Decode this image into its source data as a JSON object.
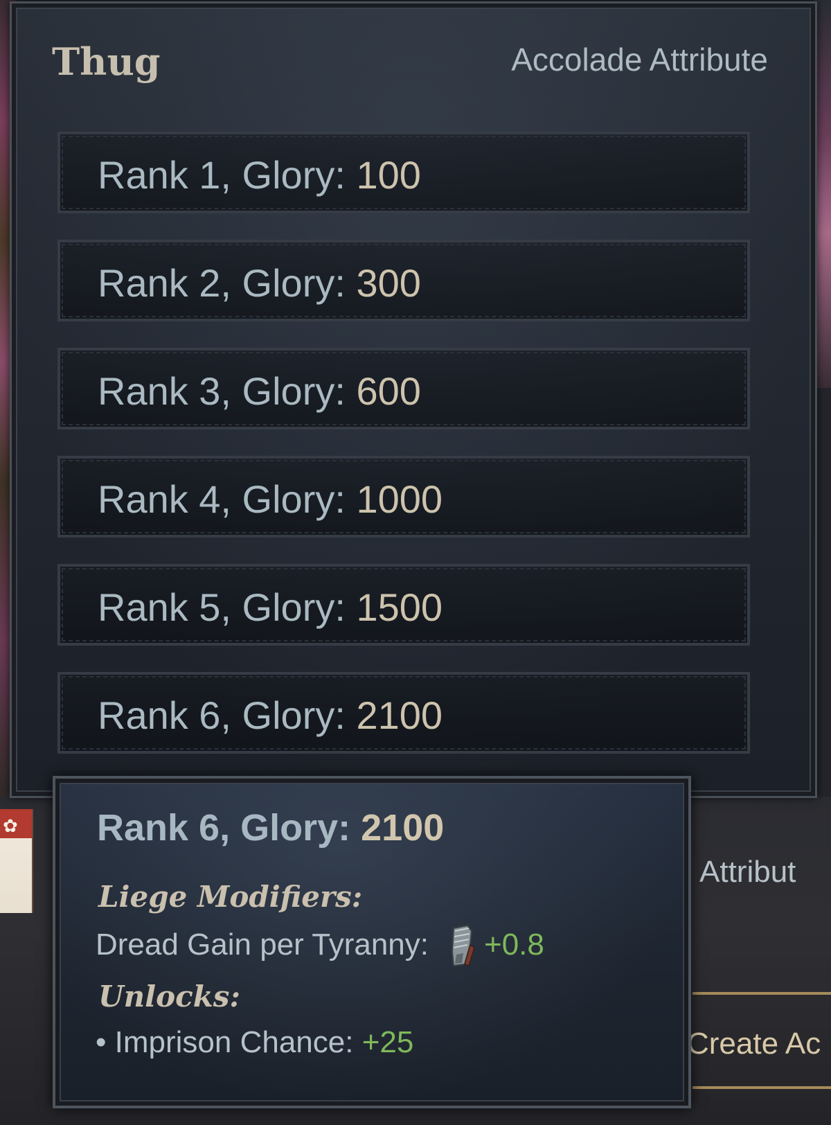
{
  "tooltip": {
    "title": "Thug",
    "subtitle": "Accolade Attribute",
    "ranks": [
      {
        "prefix": "Rank 1, Glory:",
        "value": "100"
      },
      {
        "prefix": "Rank 2, Glory:",
        "value": "300"
      },
      {
        "prefix": "Rank 3, Glory:",
        "value": "600"
      },
      {
        "prefix": "Rank 4, Glory:",
        "value": "1000"
      },
      {
        "prefix": "Rank 5, Glory:",
        "value": "1500"
      },
      {
        "prefix": "Rank 6, Glory:",
        "value": "2100"
      }
    ]
  },
  "rank_detail": {
    "heading_prefix": "Rank 6, Glory:",
    "heading_value": "2100",
    "liege_modifiers_label": "Liege Modifiers:",
    "modifier_label": "Dread Gain per Tyranny:",
    "modifier_icon": "gauntlet-icon",
    "modifier_value": "+0.8",
    "unlocks_label": "Unlocks:",
    "unlock_label": "• Imprison Chance:",
    "unlock_value": "+25"
  },
  "background": {
    "attribute_text": "Attribut",
    "create_text": "Create Ac",
    "banner_icon": "✿"
  },
  "colors": {
    "positive": "#7fb85a",
    "glory_value": "#cdc3ad",
    "rank_text": "#aab9c2"
  }
}
